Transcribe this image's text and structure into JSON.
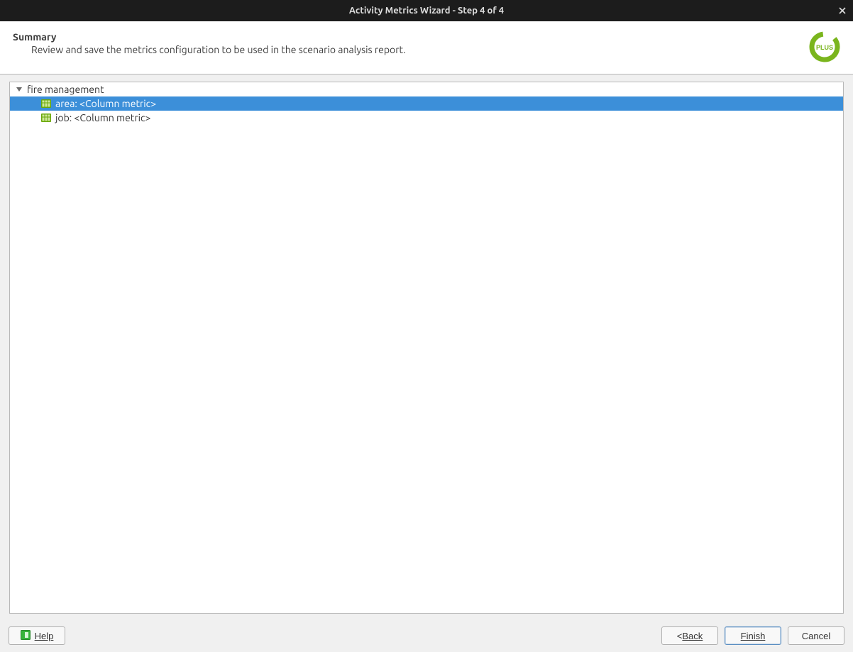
{
  "window": {
    "title": "Activity Metrics Wizard - Step 4 of 4"
  },
  "header": {
    "title": "Summary",
    "description": "Review and save the metrics configuration to be used in the scenario analysis report."
  },
  "tree": {
    "root": {
      "label": "fire management",
      "expanded": true,
      "children": [
        {
          "label": "area: <Column metric>",
          "selected": true
        },
        {
          "label": "job: <Column metric>",
          "selected": false
        }
      ]
    }
  },
  "footer": {
    "help_label": "Help",
    "back_prefix": "< ",
    "back_label": "Back",
    "finish_label": "Finish",
    "cancel_label": "Cancel"
  }
}
